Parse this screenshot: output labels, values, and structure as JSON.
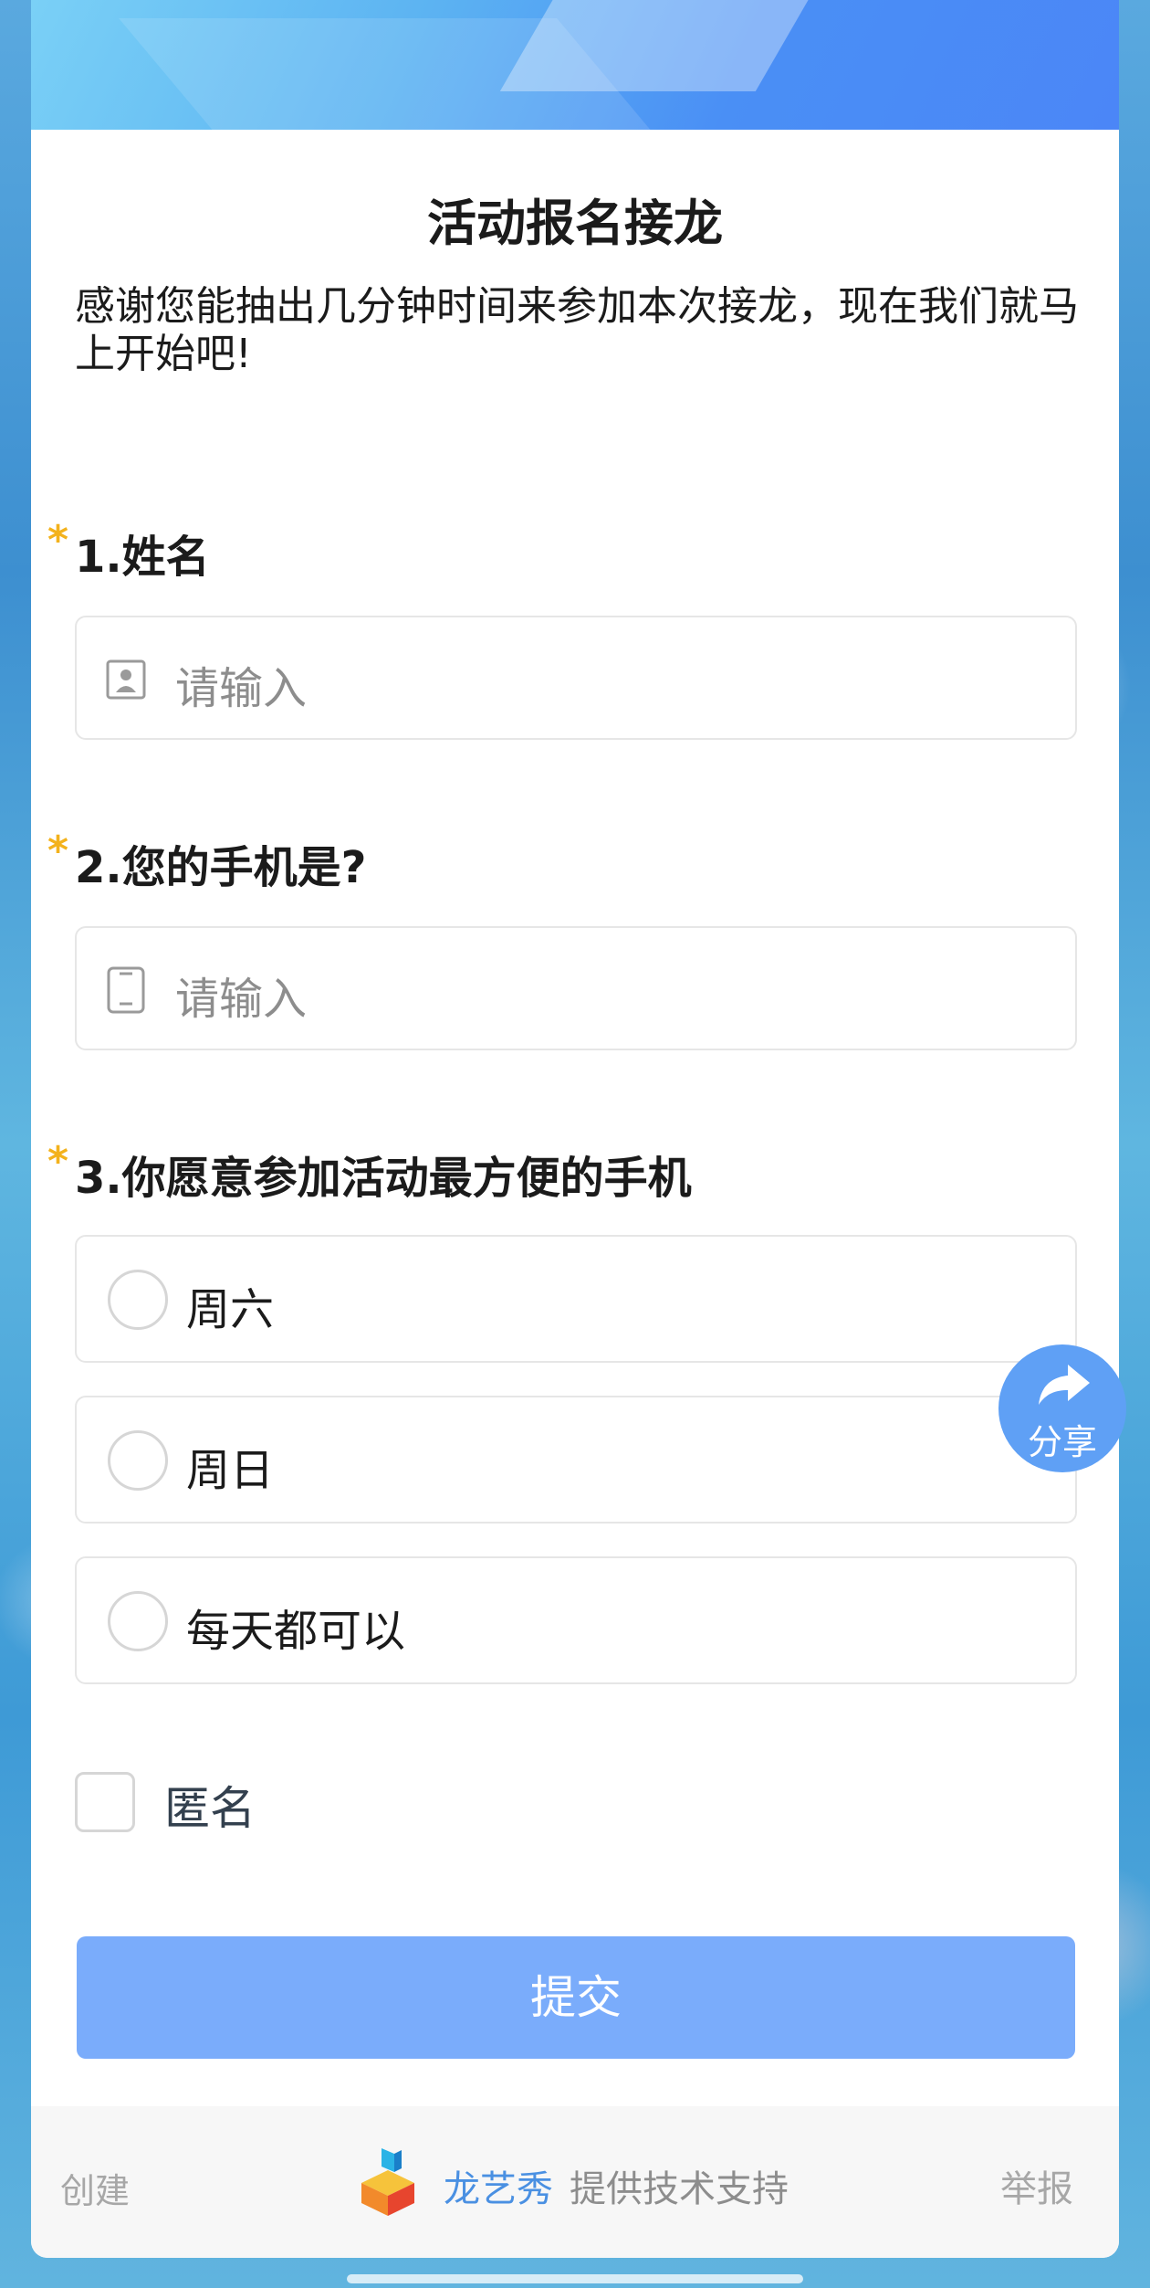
{
  "form": {
    "title": "活动报名接龙",
    "intro": "感谢您能抽出几分钟时间来参加本次接龙，现在我们就马上开始吧!",
    "questions": [
      {
        "required_mark": "*",
        "label": "1.姓名",
        "type": "text",
        "placeholder": "请输入",
        "icon": "person-card-icon"
      },
      {
        "required_mark": "*",
        "label": "2.您的手机是?",
        "type": "text",
        "placeholder": "请输入",
        "icon": "phone-icon"
      },
      {
        "required_mark": "*",
        "label": "3.你愿意参加活动最方便的手机",
        "type": "radio",
        "options": [
          "周六",
          "周日",
          "每天都可以"
        ]
      }
    ],
    "anonymous_label": "匿名",
    "submit_label": "提交"
  },
  "share": {
    "label": "分享",
    "icon": "share-arrow-icon"
  },
  "footer": {
    "create_label": "创建",
    "brand": "龙艺秀",
    "support": "提供技术支持",
    "report_label": "举报"
  },
  "colors": {
    "accent": "#4a90e2",
    "submit_bg": "#7aacfb",
    "required_star": "#f3b21c",
    "share_bg": "#5fa0f5"
  }
}
